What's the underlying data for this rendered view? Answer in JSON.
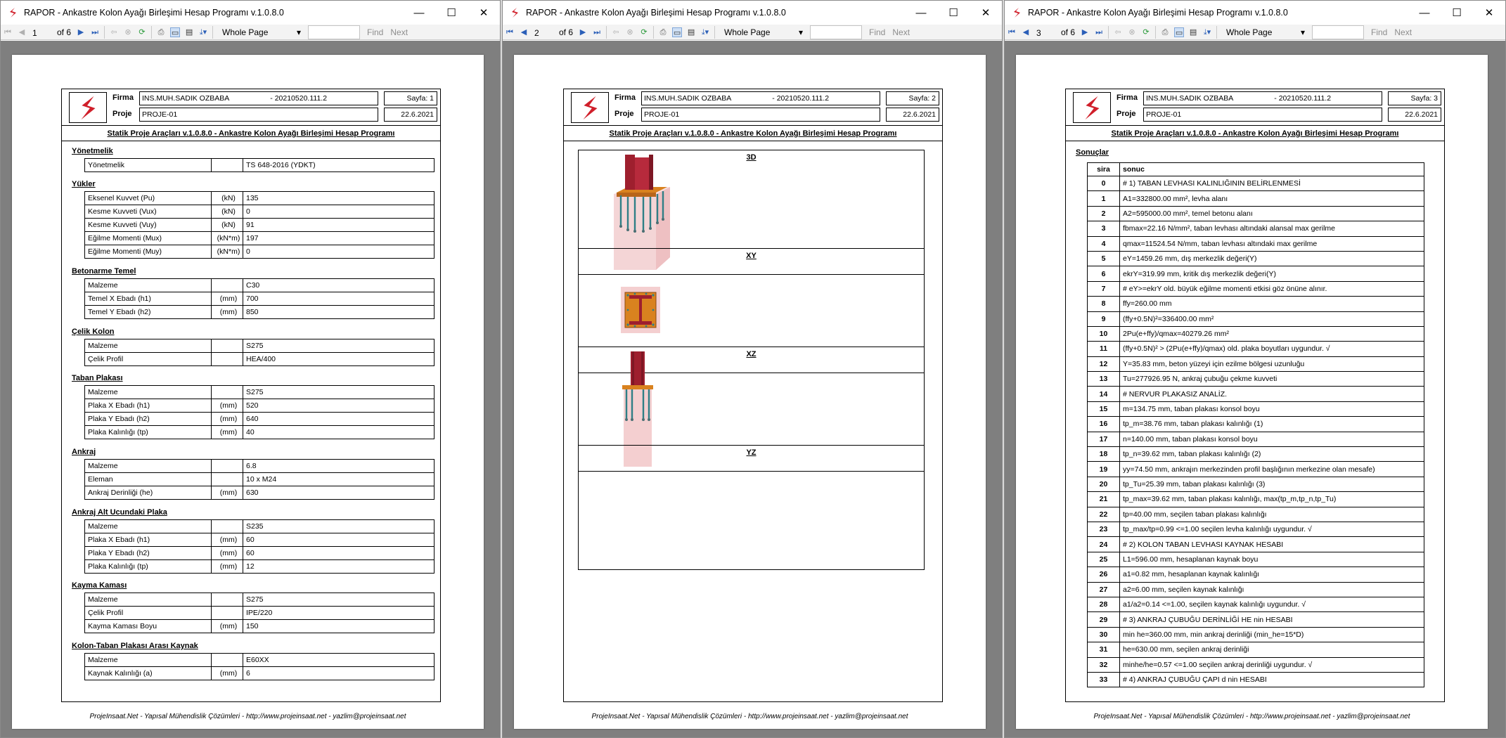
{
  "win_title": "RAPOR - Ankastre Kolon Ayağı Birleşimi Hesap Programı v.1.0.8.0",
  "toolbar": {
    "of": "of 6",
    "zoom": "Whole Page",
    "find": "Find",
    "next": "Next"
  },
  "pages": [
    "1",
    "2",
    "3"
  ],
  "head": {
    "firma_label": "Firma",
    "proje_label": "Proje",
    "firma": "INS.MUH.SADIK OZBABA",
    "code": "- 20210520.111.2",
    "sayfa1": "Sayfa: 1",
    "sayfa2": "Sayfa: 2",
    "sayfa3": "Sayfa: 3",
    "proje": "PROJE-01",
    "date": "22.6.2021",
    "subtitle": "Statik Proje Araçları v.1.0.8.0 - Ankastre Kolon Ayağı Birleşimi Hesap Programı"
  },
  "footer": "ProjeInsaat.Net - Yapısal Mühendislik Çözümleri - http://www.projeinsaat.net - yazlim@projeinsaat.net",
  "sections": [
    {
      "title": "Yönetmelik",
      "rows": [
        [
          "Yönetmelik",
          "",
          "TS 648-2016 (YDKT)"
        ]
      ]
    },
    {
      "title": "Yükler",
      "rows": [
        [
          "Eksenel Kuvvet (Pu)",
          "(kN)",
          "135"
        ],
        [
          "Kesme Kuvveti (Vux)",
          "(kN)",
          "0"
        ],
        [
          "Kesme Kuvveti (Vuy)",
          "(kN)",
          "91"
        ],
        [
          "Eğilme Momenti (Mux)",
          "(kN*m)",
          "197"
        ],
        [
          "Eğilme Momenti (Muy)",
          "(kN*m)",
          "0"
        ]
      ]
    },
    {
      "title": "Betonarme Temel",
      "rows": [
        [
          "Malzeme",
          "",
          "C30"
        ],
        [
          "Temel X Ebadı (h1)",
          "(mm)",
          "700"
        ],
        [
          "Temel Y Ebadı (h2)",
          "(mm)",
          "850"
        ]
      ]
    },
    {
      "title": "Çelik Kolon",
      "rows": [
        [
          "Malzeme",
          "",
          "S275"
        ],
        [
          "Çelik Profil",
          "",
          "HEA/400"
        ]
      ]
    },
    {
      "title": "Taban Plakası",
      "rows": [
        [
          "Malzeme",
          "",
          "S275"
        ],
        [
          "Plaka X Ebadı (h1)",
          "(mm)",
          "520"
        ],
        [
          "Plaka Y Ebadı (h2)",
          "(mm)",
          "640"
        ],
        [
          "Plaka Kalınlığı (tp)",
          "(mm)",
          "40"
        ]
      ]
    },
    {
      "title": "Ankraj",
      "rows": [
        [
          "Malzeme",
          "",
          "6.8"
        ],
        [
          "Eleman",
          "",
          "10 x M24"
        ],
        [
          "Ankraj Derinliği (he)",
          "(mm)",
          "630"
        ]
      ]
    },
    {
      "title": "Ankraj Alt Ucundaki Plaka",
      "rows": [
        [
          "Malzeme",
          "",
          "S235"
        ],
        [
          "Plaka X Ebadı (h1)",
          "(mm)",
          "60"
        ],
        [
          "Plaka Y Ebadı (h2)",
          "(mm)",
          "60"
        ],
        [
          "Plaka Kalınlığı (tp)",
          "(mm)",
          "12"
        ]
      ]
    },
    {
      "title": "Kayma Kaması",
      "rows": [
        [
          "Malzeme",
          "",
          "S275"
        ],
        [
          "Çelik Profil",
          "",
          "IPE/220"
        ],
        [
          "Kayma Kaması Boyu",
          "(mm)",
          "150"
        ]
      ]
    },
    {
      "title": "Kolon-Taban Plakası Arası Kaynak",
      "rows": [
        [
          "Malzeme",
          "",
          "E60XX"
        ],
        [
          "Kaynak Kalınlığı (a)",
          "(mm)",
          "6"
        ]
      ]
    }
  ],
  "views": [
    "3D",
    "XY",
    "XZ",
    "YZ"
  ],
  "colors": {
    "steel": "#9e1f2e",
    "plate": "#d9821f",
    "concrete": "#f4cfd0",
    "anchor": "#2f7f86"
  },
  "results_title": "Sonuçlar",
  "results_headers": [
    "sira",
    "sonuc"
  ],
  "results": [
    "# 1) TABAN LEVHASI KALINLIĞININ BELİRLENMESİ",
    "A1=332800.00 mm², levha alanı",
    "A2=595000.00 mm², temel betonu alanı",
    "fbmax=22.16 N/mm², taban levhası altındaki alansal max gerilme",
    "qmax=11524.54 N/mm, taban levhası altındaki max gerilme",
    "eY=1459.26 mm, dış merkezlik değeri(Y)",
    "ekrY=319.99 mm, kritik dış merkezlik değeri(Y)",
    "# eY>=ekrY old. büyük eğilme momenti etkisi göz önüne alınır.",
    "ffy=260.00 mm",
    "(ffy+0.5N)²=336400.00 mm²",
    "2Pu(e+ffy)/qmax=40279.26 mm²",
    "(ffy+0.5N)² > (2Pu(e+ffy)/qmax) old. plaka boyutları uygundur. √",
    "Y=35.83 mm, beton yüzeyi için ezilme bölgesi uzunluğu",
    "Tu=277926.95 N, ankraj çubuğu çekme kuvveti",
    "# NERVUR PLAKASIZ ANALİZ.",
    "m=134.75 mm, taban plakası konsol boyu",
    "tp_m=38.76 mm, taban plakası kalınlığı (1)",
    "n=140.00 mm, taban plakası konsol boyu",
    "tp_n=39.62 mm, taban plakası kalınlığı (2)",
    "yy=74.50 mm, ankrajın merkezinden profil başlığının merkezine olan mesafe)",
    "tp_Tu=25.39 mm, taban plakası kalınlığı (3)",
    "tp_max=39.62 mm, taban plakası kalınlığı, max(tp_m,tp_n,tp_Tu)",
    "tp=40.00 mm, seçilen taban plakası kalınlığı",
    "tp_max/tp=0.99 <=1.00 seçilen levha kalınlığı uygundur. √",
    "# 2) KOLON TABAN LEVHASI KAYNAK HESABI",
    "L1=596.00 mm, hesaplanan kaynak boyu",
    "a1=0.82 mm, hesaplanan kaynak kalınlığı",
    "a2=6.00 mm, seçilen kaynak kalınlığı",
    "a1/a2=0.14 <=1.00, seçilen kaynak kalınlığı uygundur. √",
    "# 3) ANKRAJ ÇUBUĞU DERİNLİĞİ HE nin HESABI",
    "min he=360.00 mm, min ankraj derinliği (min_he=15*D)",
    "he=630.00 mm, seçilen ankraj derinliği",
    "minhe/he=0.57 <=1.00 seçilen ankraj derinliği uygundur. √",
    "# 4) ANKRAJ ÇUBUĞU ÇAPI d nin HESABI"
  ]
}
